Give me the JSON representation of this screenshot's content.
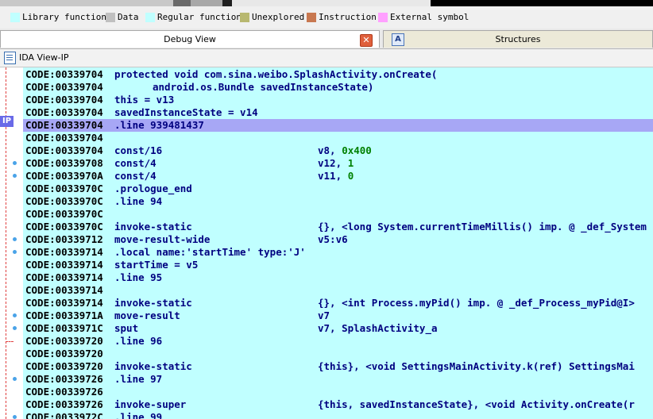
{
  "legend": [
    {
      "label": "Library function",
      "color": "#c0ffff"
    },
    {
      "label": "Data",
      "color": "#c0c0c0"
    },
    {
      "label": "Regular function",
      "color": "#c0ffff"
    },
    {
      "label": "Unexplored",
      "color": "#b8b870"
    },
    {
      "label": "Instruction",
      "color": "#c87850"
    },
    {
      "label": "External symbol",
      "color": "#ffa0ff"
    }
  ],
  "tabs": {
    "debug": "Debug View",
    "structures": "Structures",
    "close_glyph": "✕",
    "struct_glyph": "A"
  },
  "view": {
    "title": "IDA View-IP",
    "ip_label": "IP"
  },
  "colors": {
    "code_bg": "#c0ffff",
    "highlight": "#a7a7f5",
    "instruction": "#000080",
    "number": "#008000"
  },
  "lines": [
    {
      "addr": "CODE:00339704",
      "text": "protected void com.sina.weibo.SplashActivity.onCreate(",
      "indent": "none"
    },
    {
      "addr": "CODE:00339704",
      "text": "android.os.Bundle savedInstanceState)",
      "indent": "deep"
    },
    {
      "addr": "CODE:00339704",
      "text": "this = v13"
    },
    {
      "addr": "CODE:00339704",
      "text": "savedInstanceState = v14"
    },
    {
      "addr": "CODE:00339704",
      "text": ".line 939481437",
      "highlight": true
    },
    {
      "addr": "CODE:00339704",
      "text": ""
    },
    {
      "addr": "CODE:00339704",
      "text": "const/16",
      "operand": "v8, ",
      "num": "0x400"
    },
    {
      "addr": "CODE:00339708",
      "text": "const/4",
      "operand": "v12, ",
      "num": "1",
      "dot": true
    },
    {
      "addr": "CODE:0033970A",
      "text": "const/4",
      "operand": "v11, ",
      "num": "0",
      "dot": true
    },
    {
      "addr": "CODE:0033970C",
      "text": ".prologue_end"
    },
    {
      "addr": "CODE:0033970C",
      "text": ".line 94"
    },
    {
      "addr": "CODE:0033970C",
      "text": ""
    },
    {
      "addr": "CODE:0033970C",
      "text": "invoke-static",
      "operand": "{}, <long System.currentTimeMillis() imp. @ _def_System"
    },
    {
      "addr": "CODE:00339712",
      "text": "move-result-wide",
      "operand": "v5:v6",
      "dot": true
    },
    {
      "addr": "CODE:00339714",
      "text": ".local name:'startTime' type:'J'",
      "dot": true
    },
    {
      "addr": "CODE:00339714",
      "text": "startTime = v5"
    },
    {
      "addr": "CODE:00339714",
      "text": ".line 95"
    },
    {
      "addr": "CODE:00339714",
      "text": ""
    },
    {
      "addr": "CODE:00339714",
      "text": "invoke-static",
      "operand": "{}, <int Process.myPid() imp. @ _def_Process_myPid@I>"
    },
    {
      "addr": "CODE:0033971A",
      "text": "move-result",
      "operand": "v7",
      "dot": true
    },
    {
      "addr": "CODE:0033971C",
      "text": "sput",
      "operand": "v7, SplashActivity_a",
      "dot": true
    },
    {
      "addr": "CODE:00339720",
      "text": ".line 96",
      "mark": true
    },
    {
      "addr": "CODE:00339720",
      "text": ""
    },
    {
      "addr": "CODE:00339720",
      "text": "invoke-static",
      "operand": "{this}, <void SettingsMainActivity.k(ref) SettingsMai"
    },
    {
      "addr": "CODE:00339726",
      "text": ".line 97",
      "dot": true
    },
    {
      "addr": "CODE:00339726",
      "text": ""
    },
    {
      "addr": "CODE:00339726",
      "text": "invoke-super",
      "operand": "{this, savedInstanceState}, <void Activity.onCreate(r"
    },
    {
      "addr": "CODE:0033972C",
      "text": ".line 99",
      "dot": true
    }
  ]
}
